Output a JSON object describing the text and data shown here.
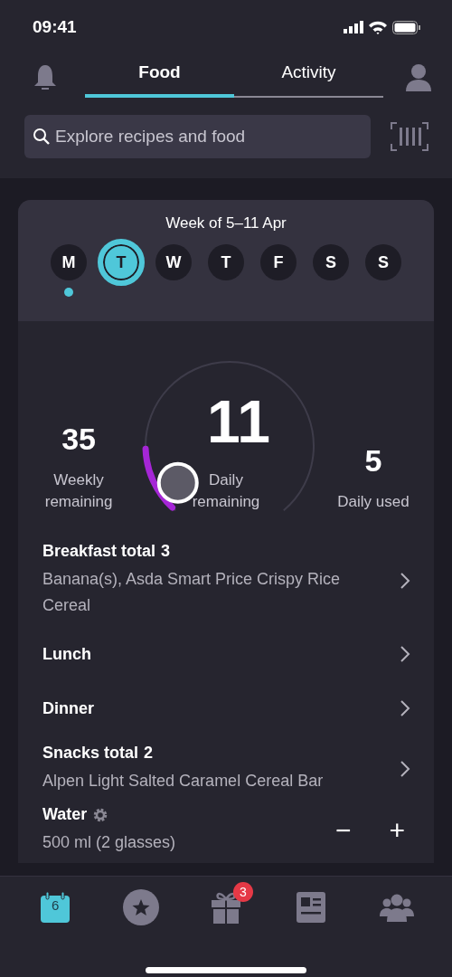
{
  "status_bar": {
    "time": "09:41"
  },
  "tabs": [
    {
      "label": "Food",
      "selected": true
    },
    {
      "label": "Activity",
      "selected": false
    }
  ],
  "search": {
    "placeholder": "Explore recipes and food"
  },
  "week": {
    "title": "Week of 5–11 Apr",
    "days": [
      {
        "letter": "M",
        "selected": false,
        "marked": true
      },
      {
        "letter": "T",
        "selected": true,
        "marked": false
      },
      {
        "letter": "W",
        "selected": false,
        "marked": false
      },
      {
        "letter": "T",
        "selected": false,
        "marked": false
      },
      {
        "letter": "F",
        "selected": false,
        "marked": false
      },
      {
        "letter": "S",
        "selected": false,
        "marked": false
      },
      {
        "letter": "S",
        "selected": false,
        "marked": false
      }
    ]
  },
  "stats": {
    "weekly": {
      "value": "35",
      "label": "Weekly remaining"
    },
    "daily": {
      "value": "11",
      "label": "Daily remaining"
    },
    "used": {
      "value": "5",
      "label": "Daily used"
    }
  },
  "meals": [
    {
      "kind": "meal",
      "title": "Breakfast total",
      "total": "3",
      "description": "Banana(s), Asda Smart Price Crispy Rice Cereal"
    },
    {
      "kind": "meal",
      "title": "Lunch"
    },
    {
      "kind": "meal",
      "title": "Dinner"
    },
    {
      "kind": "meal",
      "title": "Snacks total",
      "total": "2",
      "description": "Alpen Light Salted Caramel Cereal Bar"
    },
    {
      "kind": "water",
      "title": "Water",
      "description": "500 ml (2 glasses)",
      "minus": "−",
      "plus": "+"
    }
  ],
  "bottom_nav": [
    {
      "kind": "calendar",
      "label": "6",
      "selected": true
    },
    {
      "kind": "star",
      "selected": false
    },
    {
      "kind": "gift",
      "badge": "3",
      "selected": false
    },
    {
      "kind": "news",
      "selected": false
    },
    {
      "kind": "people",
      "selected": false
    }
  ]
}
